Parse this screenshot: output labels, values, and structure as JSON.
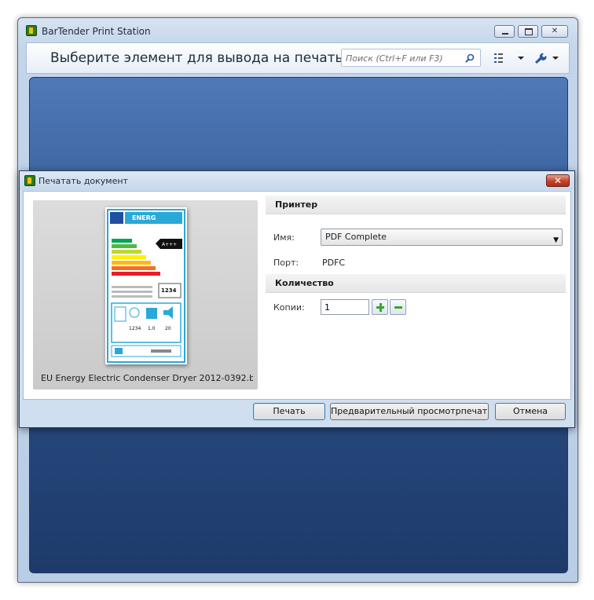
{
  "main_window": {
    "title": "BarTender Print Station",
    "heading": "Выберите элемент для вывода на печать",
    "search_placeholder": "Поиск (Ctrl+F или F3)"
  },
  "dialog": {
    "title": "Печатать документ",
    "preview_caption": "EU Energy Electric Condenser Dryer 2012-0392.b...",
    "printer_section": "Принтер",
    "name_label": "Имя:",
    "name_value": "PDF Complete",
    "port_label": "Порт:",
    "port_value": "PDFC",
    "quantity_section": "Количество",
    "copies_label": "Копии:",
    "copies_value": "1",
    "print_button": "Печать",
    "preview_button": "Предварительный просмотрпечати",
    "cancel_button": "Отмена"
  },
  "label_thumbnail": {
    "header": "ENERG",
    "rating": "A+++",
    "number": "1234",
    "values": [
      "1234",
      "1,0",
      "20"
    ],
    "colors": [
      "#00a651",
      "#50b848",
      "#bfd730",
      "#fff200",
      "#fdb913",
      "#f37021",
      "#ed1c24"
    ]
  }
}
